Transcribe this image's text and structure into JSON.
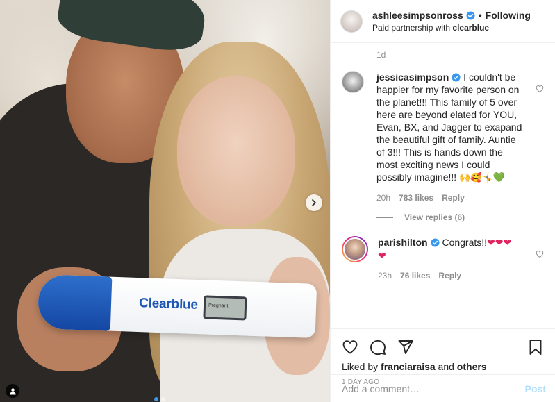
{
  "photo": {
    "brand_text": "Clearblue",
    "display_text": "Pregnant",
    "carousel_count": 2,
    "carousel_active": 0
  },
  "header": {
    "username": "ashleesimpsonross",
    "separator": "•",
    "follow_state": "Following",
    "partnership_prefix": "Paid partnership with ",
    "partner": "clearblue"
  },
  "post": {
    "age": "1d"
  },
  "comments": [
    {
      "username": "jessicasimpson",
      "text": " I couldn't be happier for my favorite person on the planet!!! This family of 5 over here are beyond elated for YOU, Evan, BX, and Jagger to exapand the beautiful gift of family. Auntie of 3!!! This is hands down the most exciting news I could possibly imagine!!!",
      "emojis": "🙌🥰🤸",
      "end_emoji": "💚",
      "time": "20h",
      "likes": "783 likes",
      "reply": "Reply",
      "view_replies": "View replies (6)"
    },
    {
      "username": "parishilton",
      "text": " Congrats!!",
      "hearts": "❤❤❤",
      "hearts_wrap": "❤",
      "time": "23h",
      "likes": "76 likes",
      "reply": "Reply"
    }
  ],
  "actions": {
    "liked_by_prefix": "Liked by ",
    "liked_by_user": "franciaraisa",
    "liked_by_and": " and ",
    "liked_by_others": "others",
    "date": "1 DAY AGO"
  },
  "add_comment": {
    "placeholder": "Add a comment…",
    "post_label": "Post"
  },
  "colors": {
    "link_disabled": "#b2dffc",
    "verified": "#3897f0",
    "heart_red": "#e0245e",
    "heart_green": "#2ca84b"
  }
}
